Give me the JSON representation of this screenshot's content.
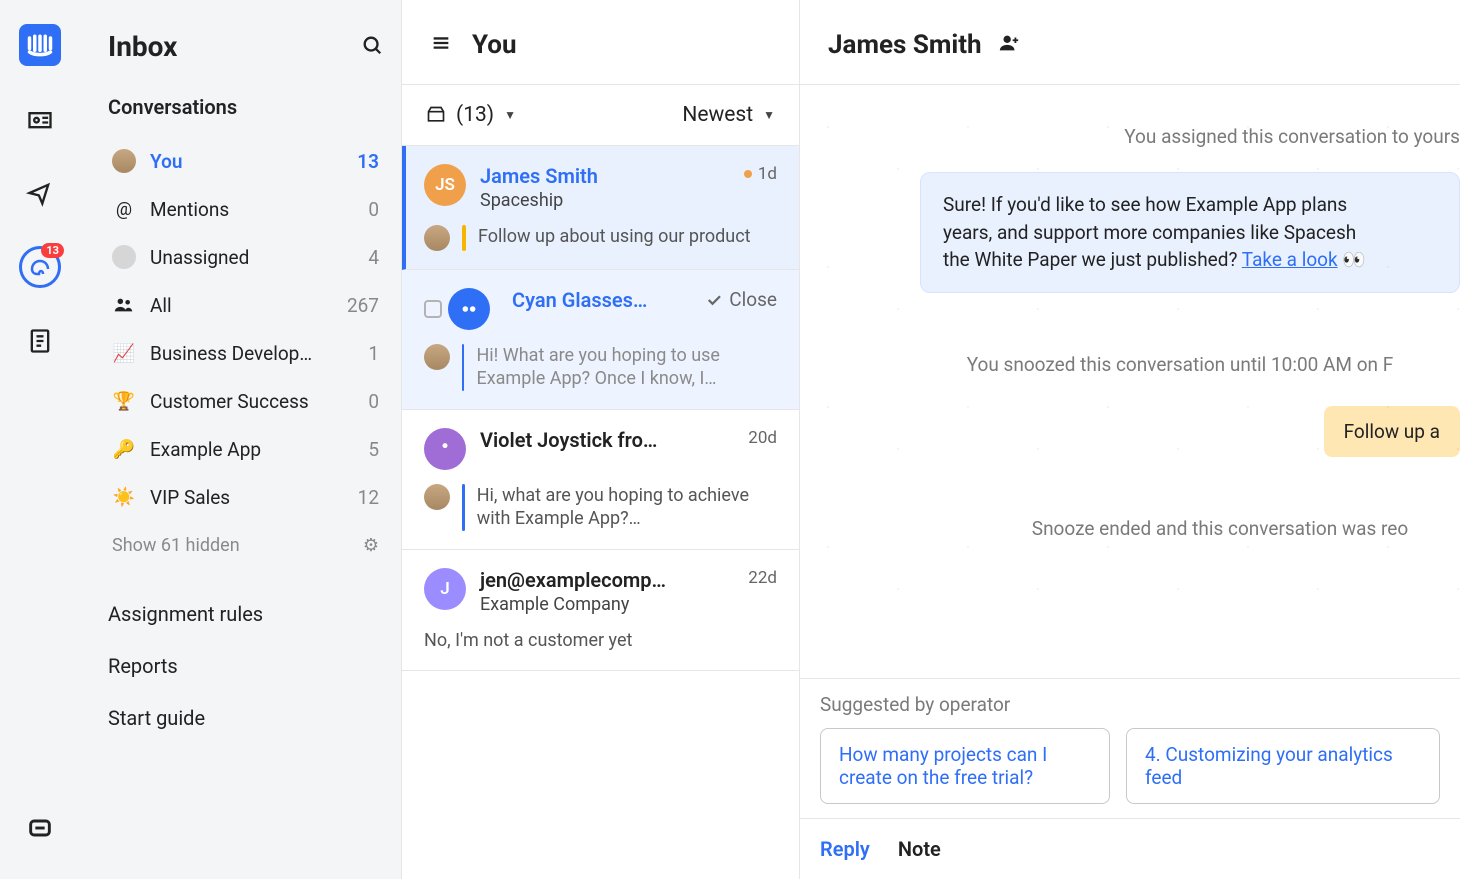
{
  "rail": {
    "badge": "13"
  },
  "sidebar": {
    "title": "Inbox",
    "section": "Conversations",
    "items": [
      {
        "label": "You",
        "count": "13",
        "active": true
      },
      {
        "label": "Mentions",
        "count": "0"
      },
      {
        "label": "Unassigned",
        "count": "4"
      },
      {
        "label": "All",
        "count": "267"
      },
      {
        "label": "Business Develop…",
        "count": "1"
      },
      {
        "label": "Customer Success",
        "count": "0"
      },
      {
        "label": "Example App",
        "count": "5"
      },
      {
        "label": "VIP Sales",
        "count": "12"
      }
    ],
    "show_hidden": "Show 61 hidden",
    "nav": {
      "assignment_rules": "Assignment rules",
      "reports": "Reports",
      "start_guide": "Start guide"
    }
  },
  "convo_header": {
    "title": "You",
    "filter_count": "(13)",
    "sort": "Newest"
  },
  "conversations": [
    {
      "name": "James Smith",
      "sub": "Spaceship",
      "meta": "1d",
      "unread": true,
      "preview": "Follow up about using our product"
    },
    {
      "name": "Cyan Glasses…",
      "close_label": "Close",
      "preview": "Hi! What are you hoping to use Example App? Once I know, I…"
    },
    {
      "name": "Violet Joystick fro…",
      "meta": "20d",
      "preview": "Hi, what are you hoping to achieve with Example App?…"
    },
    {
      "name": "jen@examplecomp…",
      "sub": "Example Company",
      "meta": "22d",
      "preview": "No, I'm not a customer yet"
    }
  ],
  "detail": {
    "name": "James Smith",
    "sys_assigned": "You assigned this conversation to yours",
    "message_part1": "Sure! If you'd like to see how Example App plans",
    "message_part2": "years, and support more companies like Spacesh",
    "message_part3": "the White Paper we just published? ",
    "message_link": "Take a look",
    "sys_snooze": "You snoozed this conversation until 10:00 AM on F",
    "note": "Follow up a",
    "sys_reopen": "Snooze ended and this conversation was reo",
    "suggest_title": "Suggested by operator",
    "suggest1": "How many projects can I create on the free trial?",
    "suggest2": "4. Customizing your analytics feed",
    "reply_tab": "Reply",
    "note_tab": "Note"
  }
}
